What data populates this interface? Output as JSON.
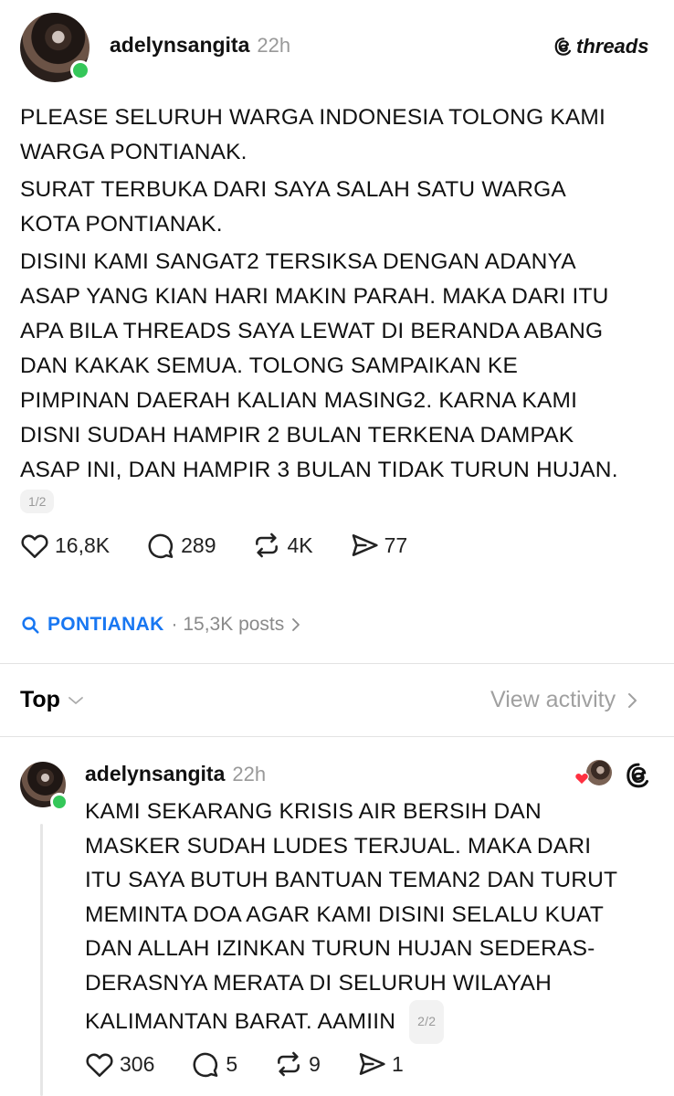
{
  "post": {
    "username": "adelynsangita",
    "time": "22h",
    "brand": "threads",
    "paragraphs": [
      [
        "PLEASE SELURUH WARGA INDONESIA TOLONG KAMI",
        "WARGA PONTIANAK."
      ],
      [
        "SURAT TERBUKA DARI SAYA SALAH SATU WARGA",
        "KOTA PONTIANAK."
      ],
      [
        "DISINI KAMI SANGAT2 TERSIKSA DENGAN ADANYA",
        "ASAP  YANG KIAN HARI MAKIN PARAH. MAKA DARI ITU",
        "APA BILA THREADS SAYA LEWAT DI BERANDA ABANG",
        "DAN KAKAK SEMUA. TOLONG SAMPAIKAN KE",
        "PIMPINAN DAERAH KALIAN MASING2. KARNA KAMI",
        "DISNI SUDAH HAMPIR 2 BULAN TERKENA DAMPAK",
        "ASAP INI, DAN HAMPIR 3 BULAN TIDAK TURUN HUJAN."
      ]
    ],
    "page_badge": "1/2",
    "likes": "16,8K",
    "comments": "289",
    "reposts": "4K",
    "shares": "77"
  },
  "topic": {
    "name": "PONTIANAK",
    "meta": "· 15,3K posts"
  },
  "sortbar": {
    "sort_label": "Top",
    "view_activity": "View activity"
  },
  "reply": {
    "username": "adelynsangita",
    "time": "22h",
    "lines": [
      "KAMI SEKARANG KRISIS AIR BERSIH DAN",
      "MASKER SUDAH LUDES TERJUAL. MAKA DARI",
      "ITU SAYA BUTUH BANTUAN TEMAN2 DAN TURUT",
      "MEMINTA DOA AGAR KAMI DISINI SELALU KUAT",
      "DAN ALLAH IZINKAN TURUN HUJAN SEDERAS-",
      "DERASNYA MERATA DI SELURUH WILAYAH",
      "KALIMANTAN BARAT. AAMIIN"
    ],
    "page_badge": "2/2",
    "likes": "306",
    "comments": "5",
    "reposts": "9",
    "shares": "1"
  },
  "icons": {
    "like": "heart-icon",
    "comment": "comment-icon",
    "repost": "repost-icon",
    "share": "share-icon",
    "search": "search-icon",
    "chevron_right": "chevron-right-icon",
    "chevron_down": "chevron-down-icon",
    "threads_logo": "threads-logo-icon"
  },
  "colors": {
    "online": "#34c759",
    "topic": "#1877f2",
    "muted": "#999999"
  }
}
